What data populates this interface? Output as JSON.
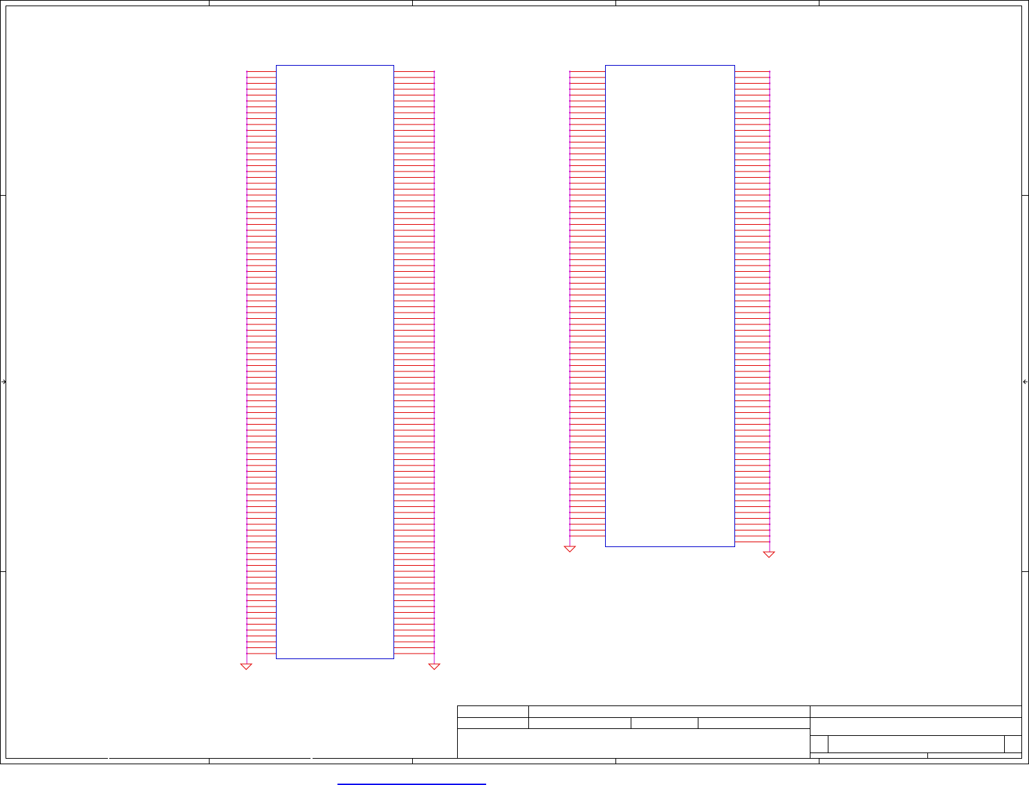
{
  "document": {
    "kind": "schematic-sheet",
    "colors": {
      "border": "#000000",
      "wire": "#e00000",
      "component_outline": "#0000cc",
      "pin_end": "#cc00cc",
      "ground_symbol": "#e00000",
      "link": "#0000ee"
    }
  },
  "components": [
    {
      "id": "connector-left",
      "left_pins": 100,
      "right_pins": 100,
      "ground_symbols": 2
    },
    {
      "id": "connector-right",
      "left_pins": 80,
      "right_pins": 81,
      "ground_symbols": 2
    }
  ],
  "title_block": {
    "cells": [
      "",
      "",
      "",
      "",
      "",
      "",
      "",
      "",
      ""
    ]
  }
}
